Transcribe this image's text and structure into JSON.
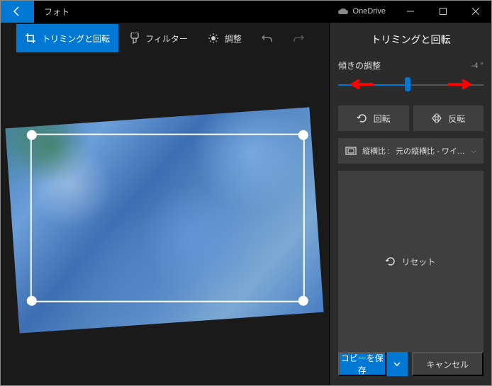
{
  "app": {
    "title": "フォト",
    "onedrive": "OneDrive"
  },
  "toolbar": {
    "crop_rotate": "トリミングと回転",
    "filter": "フィルター",
    "adjust": "調整"
  },
  "panel": {
    "title": "トリミングと回転",
    "tilt_label": "傾きの調整",
    "tilt_value": "-4 °",
    "rotate": "回転",
    "flip": "反転",
    "aspect_label": "縦横比 :",
    "aspect_value": "元の縦横比 - ワイド...",
    "reset": "リセット"
  },
  "footer": {
    "save": "コピーを保存",
    "cancel": "キャンセル"
  }
}
